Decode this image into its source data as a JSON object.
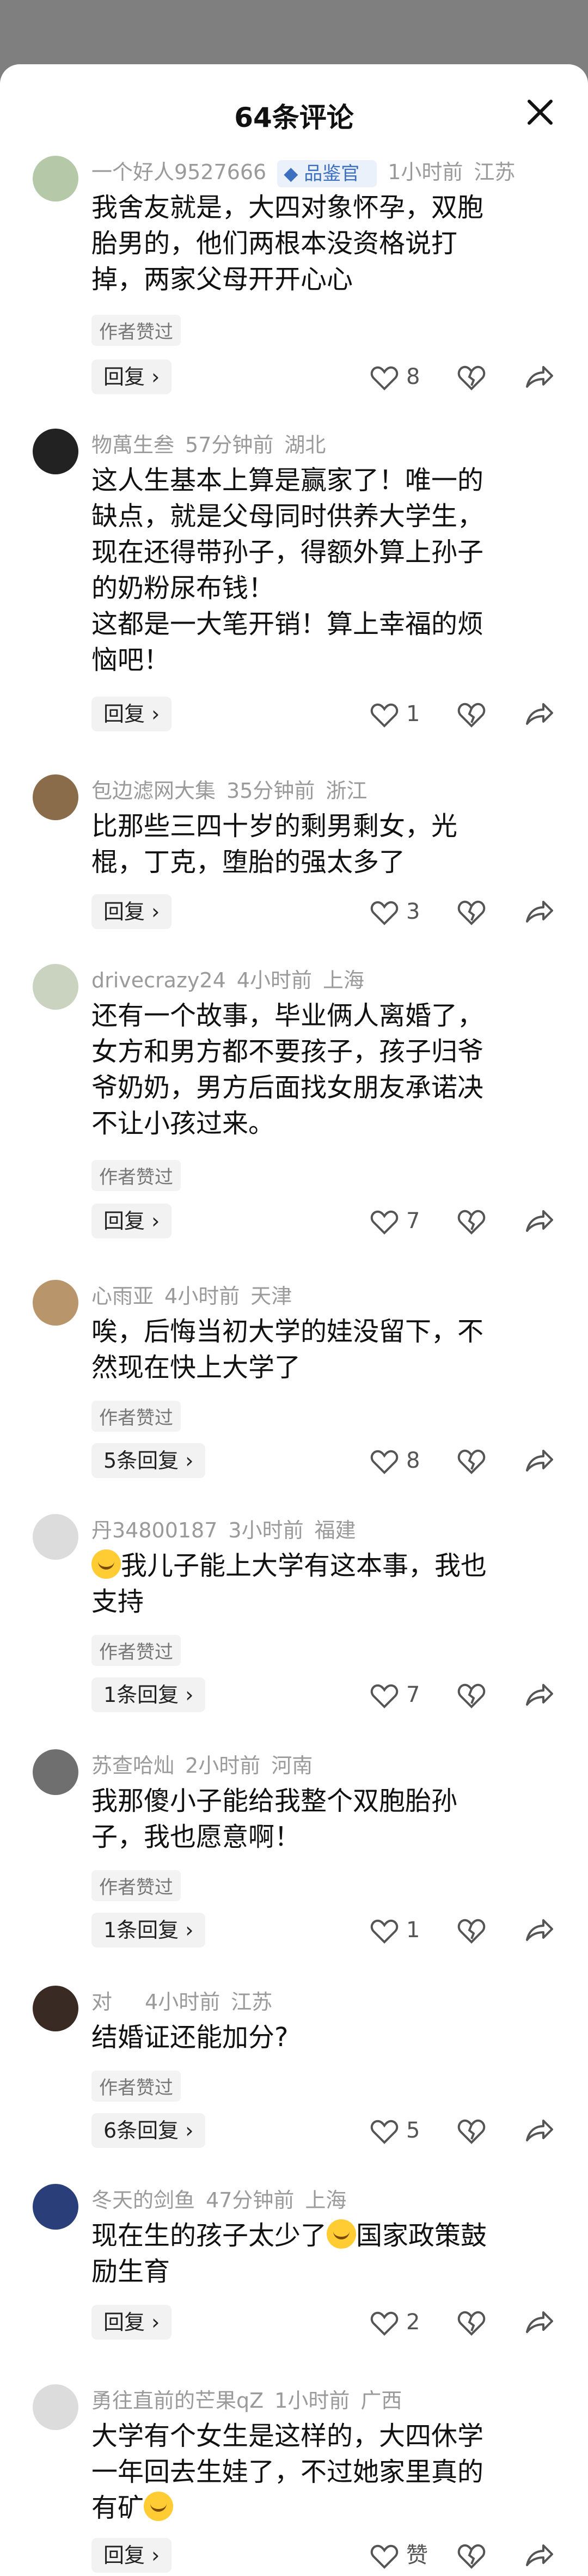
{
  "header": {
    "title": "64条评论"
  },
  "colors": {
    "accent": "#3c6fbf",
    "meta": "#9a9a9a",
    "overlay": "#7f7f7f"
  },
  "comments": [
    {
      "user": "一个好人9527666",
      "badge": "品鉴官",
      "time": "1小时前",
      "region": "江苏",
      "text": "我舍友就是，大四对象怀孕，双胞\n胎男的，他们两根本没资格说打\n掉，两家父母开开心心",
      "author_liked": "作者赞过",
      "reply": "回复 ›",
      "likes": "8"
    },
    {
      "user": "物萬生叁",
      "time": "57分钟前",
      "region": "湖北",
      "text": "这人生基本上算是赢家了！唯一的\n缺点，就是父母同时供养大学生，\n现在还得带孙子，得额外算上孙子\n的奶粉尿布钱！\n这都是一大笔开销！算上幸福的烦\n恼吧！",
      "reply": "回复 ›",
      "likes": "1"
    },
    {
      "user": "包边滤网大集",
      "time": "35分钟前",
      "region": "浙江",
      "text": "比那些三四十岁的剩男剩女，光\n棍，丁克，堕胎的强太多了",
      "reply": "回复 ›",
      "likes": "3"
    },
    {
      "user": "drivecrazy24",
      "time": "4小时前",
      "region": "上海",
      "text": "还有一个故事，毕业俩人离婚了，\n女方和男方都不要孩子，孩子归爷\n爷奶奶，男方后面找女朋友承诺决\n不让小孩过来。",
      "author_liked": "作者赞过",
      "reply": "回复 ›",
      "likes": "7"
    },
    {
      "user": "心雨亚",
      "time": "4小时前",
      "region": "天津",
      "text": "唉，后悔当初大学的娃没留下，不\n然现在快上大学了",
      "author_liked": "作者赞过",
      "reply": "5条回复 ›",
      "likes": "8"
    },
    {
      "user": "丹34800187",
      "time": "3小时前",
      "region": "福建",
      "text": "我儿子能上大学有这本事，我也\n支持",
      "author_liked": "作者赞过",
      "reply": "1条回复 ›",
      "likes": "7"
    },
    {
      "user": "苏查哈灿",
      "time": "2小时前",
      "region": "河南",
      "text": "我那傻小子能给我整个双胞胎孙\n子，我也愿意啊！",
      "author_liked": "作者赞过",
      "reply": "1条回复 ›",
      "likes": "1"
    },
    {
      "user": "对",
      "time": "4小时前",
      "region": "江苏",
      "text": "结婚证还能加分?",
      "author_liked": "作者赞过",
      "reply": "6条回复 ›",
      "likes": "5"
    },
    {
      "user": "冬天的剑鱼",
      "time": "47分钟前",
      "region": "上海",
      "text": "现在生的孩子太少了",
      "text_suffix": "国家政策鼓\n励生育",
      "reply": "回复 ›",
      "likes": "2"
    },
    {
      "user": "勇往直前的芒果qZ",
      "time": "1小时前",
      "region": "广西",
      "text": "大学有个女生是这样的，大四休学\n一年回去生娃了，不过她家里真的\n有矿",
      "reply": "回复 ›",
      "likes": "赞"
    }
  ]
}
